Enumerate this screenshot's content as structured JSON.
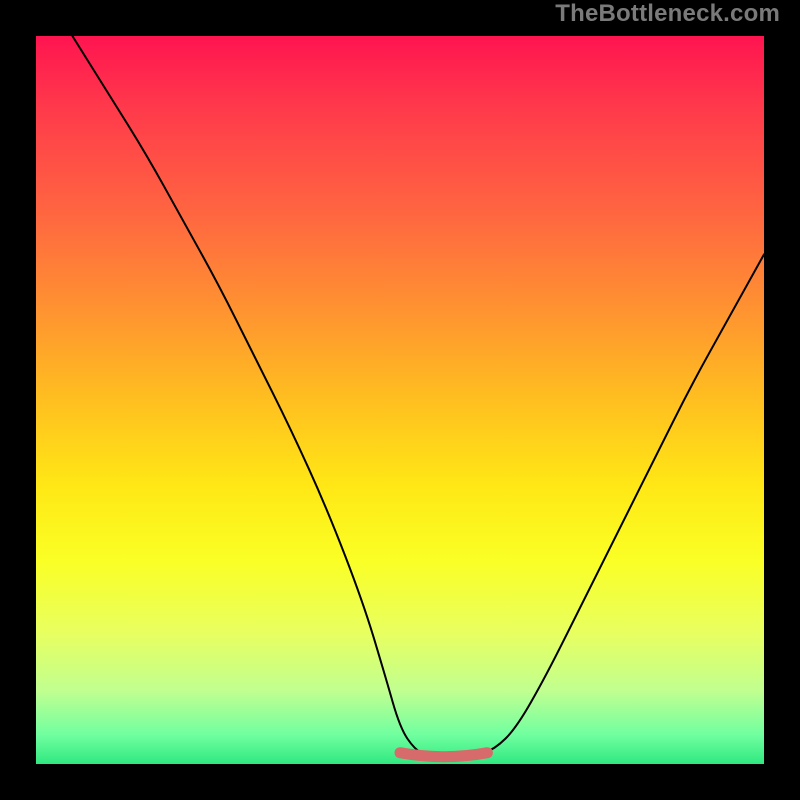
{
  "watermark": "TheBottleneck.com",
  "chart_data": {
    "type": "line",
    "title": "",
    "xlabel": "",
    "ylabel": "",
    "xlim": [
      0,
      100
    ],
    "ylim": [
      0,
      100
    ],
    "series": [
      {
        "name": "curve",
        "x": [
          5,
          10,
          15,
          20,
          25,
          30,
          35,
          40,
          45,
          48,
          50,
          52,
          54,
          56,
          58,
          60,
          63,
          66,
          70,
          75,
          80,
          85,
          90,
          95,
          100
        ],
        "values": [
          100,
          92,
          84,
          75,
          66,
          56,
          46,
          35,
          22,
          12,
          5,
          2,
          1,
          0.5,
          0.5,
          1,
          2,
          5,
          12,
          22,
          32,
          42,
          52,
          61,
          70
        ]
      }
    ],
    "bottom_segment": {
      "x_start": 50,
      "x_end": 62,
      "y": 1
    },
    "gradient_stops": [
      {
        "pos": 0,
        "color": "#ff1450"
      },
      {
        "pos": 10,
        "color": "#ff3a4b"
      },
      {
        "pos": 25,
        "color": "#ff6840"
      },
      {
        "pos": 38,
        "color": "#ff9430"
      },
      {
        "pos": 50,
        "color": "#ffbf20"
      },
      {
        "pos": 62,
        "color": "#ffe815"
      },
      {
        "pos": 72,
        "color": "#faff25"
      },
      {
        "pos": 82,
        "color": "#e8ff60"
      },
      {
        "pos": 90,
        "color": "#c0ff90"
      },
      {
        "pos": 96,
        "color": "#70ffa0"
      },
      {
        "pos": 100,
        "color": "#30e880"
      }
    ]
  }
}
